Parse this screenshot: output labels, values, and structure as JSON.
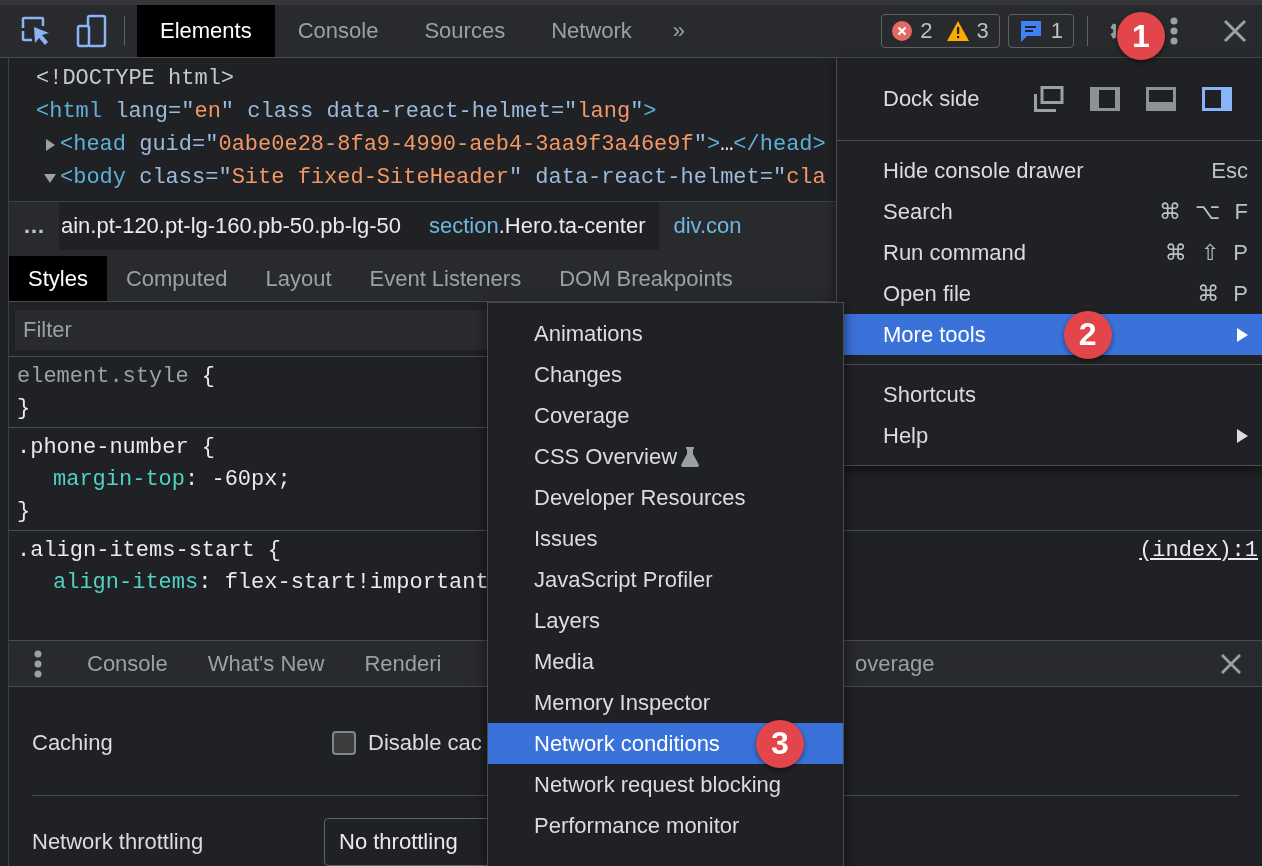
{
  "toolbar": {
    "main_tabs": [
      {
        "label": "Elements",
        "selected": true
      },
      {
        "label": "Console",
        "selected": false
      },
      {
        "label": "Sources",
        "selected": false
      },
      {
        "label": "Network",
        "selected": false
      }
    ],
    "overflow": "»",
    "issue_counts": {
      "errors": "2",
      "warnings": "3"
    },
    "message_count": "1",
    "menu_callout": "1"
  },
  "dom_tree": [
    {
      "tokens": [
        {
          "kind": "doctype",
          "text": "<!DOCTYPE html>"
        }
      ]
    },
    {
      "tokens": [
        {
          "kind": "tag",
          "text": "<html"
        },
        {
          "kind": "attr",
          "text": " lang=\""
        },
        {
          "kind": "value",
          "text": "en"
        },
        {
          "kind": "attr",
          "text": "\" class data-react-helmet=\""
        },
        {
          "kind": "value",
          "text": "lang"
        },
        {
          "kind": "attr",
          "text": "\""
        },
        {
          "kind": "tag",
          "text": ">"
        }
      ],
      "children": [
        {
          "expanded": false,
          "tokens": [
            {
              "kind": "tag",
              "text": "<head"
            },
            {
              "kind": "attr",
              "text": " guid=\""
            },
            {
              "kind": "value",
              "text": "0abe0e28-8fa9-4990-aeb4-3aa9f3a46e9f"
            },
            {
              "kind": "attr",
              "text": "\""
            },
            {
              "kind": "tag",
              "text": ">"
            },
            {
              "kind": "plain",
              "text": "…"
            },
            {
              "kind": "tag",
              "text": "</head>"
            }
          ]
        },
        {
          "expanded": true,
          "tokens": [
            {
              "kind": "tag",
              "text": "<body"
            },
            {
              "kind": "attr",
              "text": " class=\""
            },
            {
              "kind": "value",
              "text": "Site fixed-SiteHeader"
            },
            {
              "kind": "attr",
              "text": "\" data-react-helmet=\""
            },
            {
              "kind": "value",
              "text": "cla"
            }
          ]
        }
      ]
    }
  ],
  "breadcrumbs": {
    "overflow": "…",
    "items": [
      {
        "classes": "ain.pt-120.pt-lg-160.pb-50.pb-lg-50"
      },
      {
        "tag": "section",
        "classes": ".Hero.ta-center"
      },
      {
        "tag": "div.con"
      }
    ]
  },
  "sidebar_tabs": [
    {
      "label": "Styles",
      "selected": true
    },
    {
      "label": "Computed",
      "selected": false
    },
    {
      "label": "Layout",
      "selected": false
    },
    {
      "label": "Event Listeners",
      "selected": false
    },
    {
      "label": "DOM Breakpoints",
      "selected": false
    }
  ],
  "filter": {
    "placeholder": "Filter"
  },
  "style_rules": [
    {
      "selector": "element.style",
      "kind": "inline",
      "open": "{",
      "close": "}"
    },
    {
      "selector": ".phone-number",
      "kind": "class",
      "open": "{",
      "declarations": [
        {
          "property": "margin-top",
          "separator": ":",
          "value": "-60px;"
        }
      ],
      "close": "}"
    },
    {
      "selector": ".align-items-start",
      "kind": "class",
      "open": "{",
      "source": "(index):1",
      "declarations": [
        {
          "property": "align-items",
          "separator": ":",
          "value": "flex-start!important"
        }
      ]
    }
  ],
  "drawer": {
    "tabs": [
      "Console",
      "What's New",
      "Renderi"
    ],
    "trailing_tabs": [
      "overage"
    ]
  },
  "network_conditions": {
    "caching": {
      "label": "Caching",
      "checkbox_label": "Disable cac",
      "checked": false
    },
    "throttling": {
      "label": "Network throttling",
      "value": "No throttling"
    }
  },
  "main_menu": {
    "dock": {
      "label": "Dock side",
      "options": [
        {
          "kind": "undock",
          "selected": false
        },
        {
          "kind": "left",
          "selected": false
        },
        {
          "kind": "bottom",
          "selected": false
        },
        {
          "kind": "right",
          "selected": true
        }
      ]
    },
    "sections": [
      {
        "items": [
          {
            "label": "Hide console drawer",
            "shortcut": "Esc",
            "submenu": false,
            "selected": false
          },
          {
            "label": "Search",
            "shortcut": "⌘ ⌥ F",
            "submenu": false,
            "selected": false
          },
          {
            "label": "Run command",
            "shortcut": "⌘ ⇧ P",
            "submenu": false,
            "selected": false
          },
          {
            "label": "Open file",
            "shortcut": "⌘ P",
            "submenu": false,
            "selected": false
          },
          {
            "label": "More tools",
            "submenu": true,
            "selected": true,
            "callout": "2"
          }
        ]
      },
      {
        "items": [
          {
            "label": "Shortcuts",
            "submenu": false,
            "selected": false
          },
          {
            "label": "Help",
            "submenu": true,
            "selected": false
          }
        ]
      }
    ]
  },
  "submenu": {
    "items": [
      {
        "label": "Animations",
        "experimental": false,
        "selected": false
      },
      {
        "label": "Changes",
        "experimental": false,
        "selected": false
      },
      {
        "label": "Coverage",
        "experimental": false,
        "selected": false
      },
      {
        "label": "CSS Overview",
        "experimental": true,
        "selected": false
      },
      {
        "label": "Developer Resources",
        "experimental": false,
        "selected": false
      },
      {
        "label": "Issues",
        "experimental": false,
        "selected": false
      },
      {
        "label": "JavaScript Profiler",
        "experimental": false,
        "selected": false
      },
      {
        "label": "Layers",
        "experimental": false,
        "selected": false
      },
      {
        "label": "Media",
        "experimental": false,
        "selected": false
      },
      {
        "label": "Memory Inspector",
        "experimental": false,
        "selected": false
      },
      {
        "label": "Network conditions",
        "experimental": false,
        "selected": true,
        "callout": "3"
      },
      {
        "label": "Network request blocking",
        "experimental": false,
        "selected": false
      },
      {
        "label": "Performance monitor",
        "experimental": false,
        "selected": false
      }
    ]
  }
}
